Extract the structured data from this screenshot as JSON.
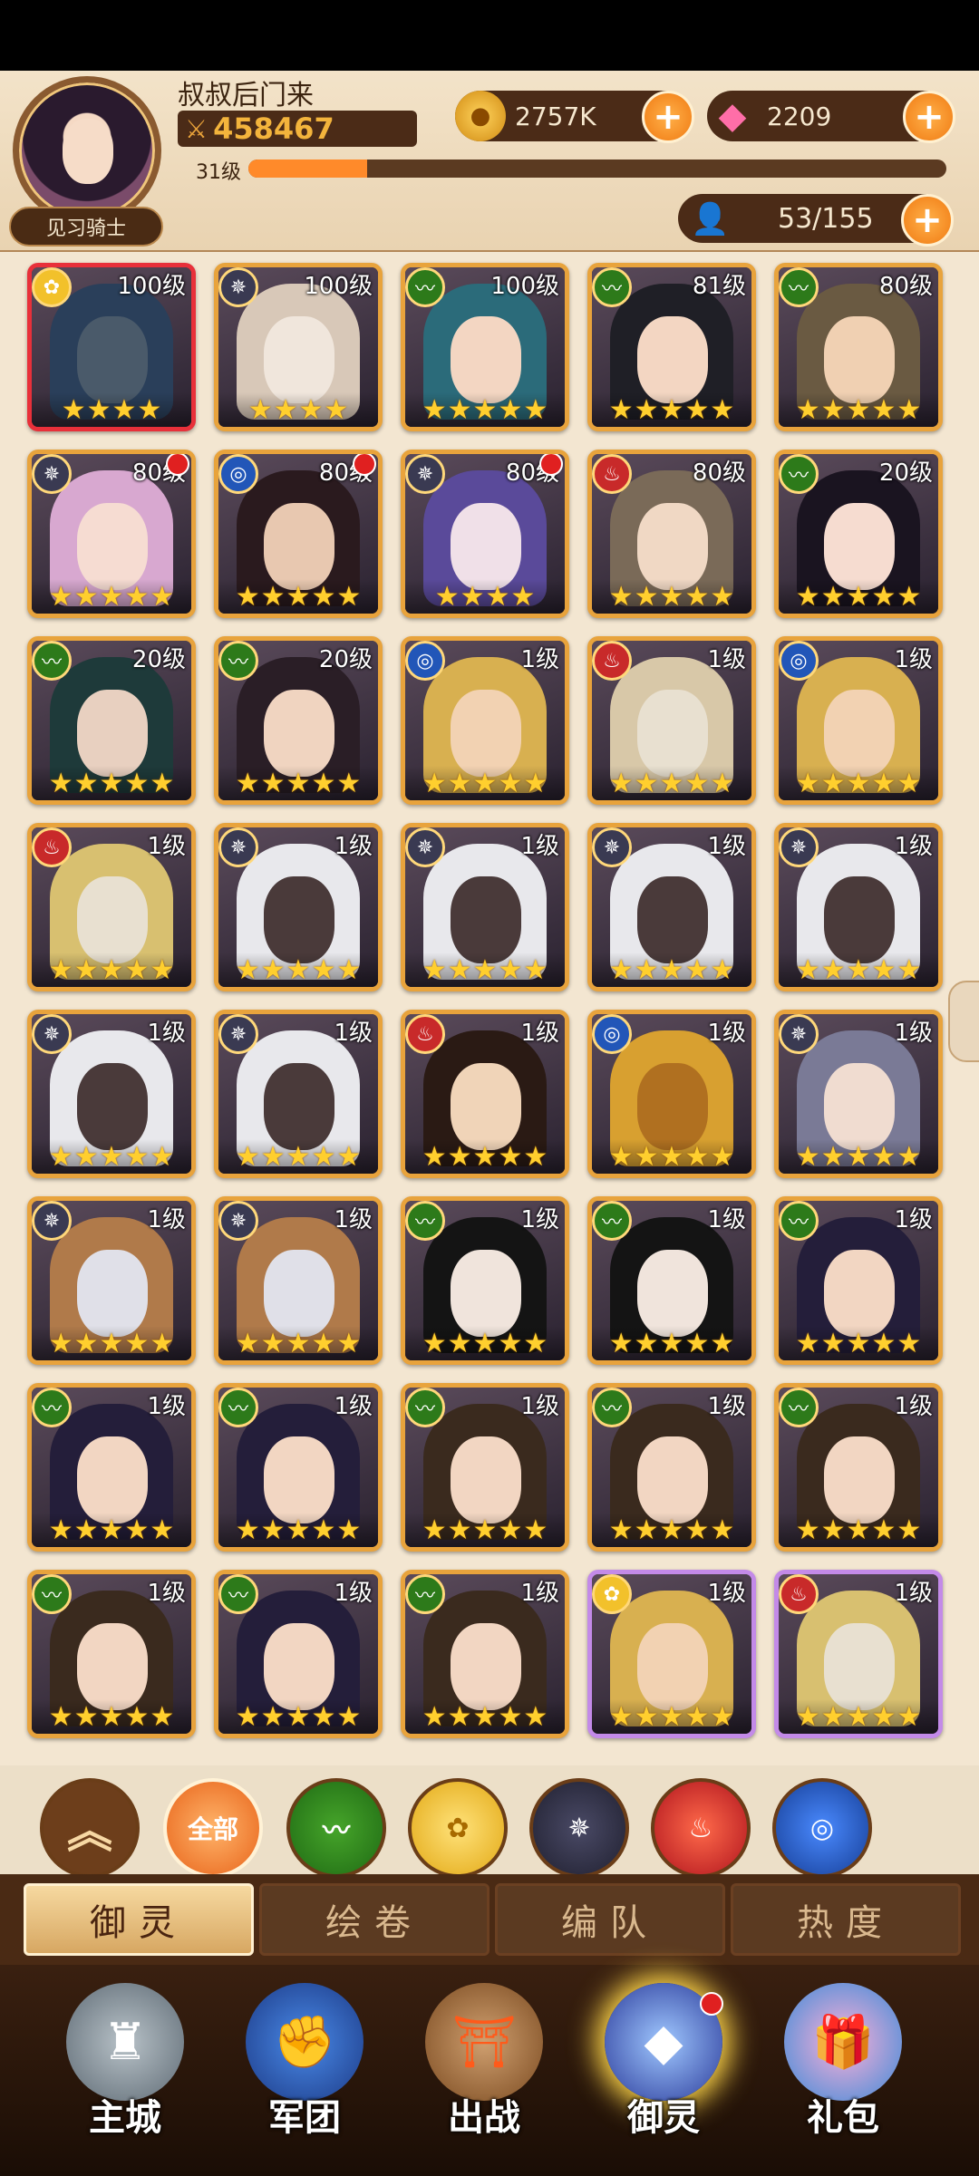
{
  "player": {
    "name": "叔叔后门来",
    "power": "458467",
    "level": "31级",
    "exp_fraction": 0.17,
    "rank": "见习骑士"
  },
  "resources": {
    "gold": "2757K",
    "gems": "2209",
    "roster": "53/155"
  },
  "cards": [
    {
      "level": "100级",
      "faction": "light",
      "frame": "red",
      "stars": 4,
      "dot": false,
      "hair": "#2a3f5a",
      "face": "#4a5a6a"
    },
    {
      "level": "100级",
      "faction": "dark",
      "frame": "gold",
      "stars": 4,
      "dot": false,
      "hair": "#d8c8b8",
      "face": "#f0e6dc"
    },
    {
      "level": "100级",
      "faction": "nature",
      "frame": "gold",
      "stars": 5,
      "dot": false,
      "hair": "#2b6b7a",
      "face": "#f3d6c2"
    },
    {
      "level": "81级",
      "faction": "nature",
      "frame": "gold",
      "stars": 5,
      "dot": false,
      "hair": "#1f1f26",
      "face": "#f3d6c2"
    },
    {
      "level": "80级",
      "faction": "nature",
      "frame": "gold",
      "stars": 5,
      "dot": false,
      "hair": "#6a5a42",
      "face": "#f0d0b2"
    },
    {
      "level": "80级",
      "faction": "dark",
      "frame": "gold",
      "stars": 5,
      "dot": true,
      "hair": "#d8a8d0",
      "face": "#f6dcd2"
    },
    {
      "level": "80级",
      "faction": "water",
      "frame": "gold",
      "stars": 5,
      "dot": true,
      "hair": "#2a1a1e",
      "face": "#e8c8b0"
    },
    {
      "level": "80级",
      "faction": "dark",
      "frame": "gold",
      "stars": 4,
      "dot": true,
      "hair": "#5a4a9a",
      "face": "#f0e0e8"
    },
    {
      "level": "80级",
      "faction": "fire",
      "frame": "gold",
      "stars": 5,
      "dot": false,
      "hair": "#7a6a58",
      "face": "#f0d8c4"
    },
    {
      "level": "20级",
      "faction": "nature",
      "frame": "gold",
      "stars": 5,
      "dot": false,
      "hair": "#1a1420",
      "face": "#f6dcd0"
    },
    {
      "level": "20级",
      "faction": "nature",
      "frame": "gold",
      "stars": 5,
      "dot": false,
      "hair": "#1e3a3a",
      "face": "#e8d0c0"
    },
    {
      "level": "20级",
      "faction": "nature",
      "frame": "gold",
      "stars": 5,
      "dot": false,
      "hair": "#2a1e26",
      "face": "#f0d4c0"
    },
    {
      "level": "1级",
      "faction": "water",
      "frame": "gold",
      "stars": 5,
      "dot": false,
      "hair": "#d8b050",
      "face": "#f2d2b2"
    },
    {
      "level": "1级",
      "faction": "fire",
      "frame": "gold",
      "stars": 5,
      "dot": false,
      "hair": "#d8c8a8",
      "face": "#e8e0d0"
    },
    {
      "level": "1级",
      "faction": "water",
      "frame": "gold",
      "stars": 5,
      "dot": false,
      "hair": "#d8b050",
      "face": "#f2d2b2"
    },
    {
      "level": "1级",
      "faction": "fire",
      "frame": "gold",
      "stars": 5,
      "dot": false,
      "hair": "#d8c070",
      "face": "#e8e0d0"
    },
    {
      "level": "1级",
      "faction": "dark",
      "frame": "gold",
      "stars": 5,
      "dot": false,
      "hair": "#e8e8ec",
      "face": "#4a3a3a"
    },
    {
      "level": "1级",
      "faction": "dark",
      "frame": "gold",
      "stars": 5,
      "dot": false,
      "hair": "#e8e8ec",
      "face": "#4a3a3a"
    },
    {
      "level": "1级",
      "faction": "dark",
      "frame": "gold",
      "stars": 5,
      "dot": false,
      "hair": "#e8e8ec",
      "face": "#4a3a3a"
    },
    {
      "level": "1级",
      "faction": "dark",
      "frame": "gold",
      "stars": 5,
      "dot": false,
      "hair": "#e8e8ec",
      "face": "#4a3a3a"
    },
    {
      "level": "1级",
      "faction": "dark",
      "frame": "gold",
      "stars": 5,
      "dot": false,
      "hair": "#e8e8ec",
      "face": "#4a3a3a"
    },
    {
      "level": "1级",
      "faction": "dark",
      "frame": "gold",
      "stars": 5,
      "dot": false,
      "hair": "#e8e8ec",
      "face": "#4a3a3a"
    },
    {
      "level": "1级",
      "faction": "fire",
      "frame": "gold",
      "stars": 5,
      "dot": false,
      "hair": "#2a1a14",
      "face": "#f0d4b8"
    },
    {
      "level": "1级",
      "faction": "water",
      "frame": "gold",
      "stars": 5,
      "dot": false,
      "hair": "#d8a030",
      "face": "#b07020"
    },
    {
      "level": "1级",
      "faction": "dark",
      "frame": "gold",
      "stars": 5,
      "dot": false,
      "hair": "#7a7a96",
      "face": "#f0dcd0"
    },
    {
      "level": "1级",
      "faction": "dark",
      "frame": "gold",
      "stars": 5,
      "dot": false,
      "hair": "#b07a4a",
      "face": "#e0e0e8"
    },
    {
      "level": "1级",
      "faction": "dark",
      "frame": "gold",
      "stars": 5,
      "dot": false,
      "hair": "#b07a4a",
      "face": "#e0e0e8"
    },
    {
      "level": "1级",
      "faction": "nature",
      "frame": "gold",
      "stars": 5,
      "dot": false,
      "hair": "#141414",
      "face": "#f0e4dc"
    },
    {
      "level": "1级",
      "faction": "nature",
      "frame": "gold",
      "stars": 5,
      "dot": false,
      "hair": "#141414",
      "face": "#f0e4dc"
    },
    {
      "level": "1级",
      "faction": "nature",
      "frame": "gold",
      "stars": 5,
      "dot": false,
      "hair": "#241e3a",
      "face": "#f2d6c2"
    },
    {
      "level": "1级",
      "faction": "nature",
      "frame": "gold",
      "stars": 5,
      "dot": false,
      "hair": "#241e3a",
      "face": "#f2d6c2"
    },
    {
      "level": "1级",
      "faction": "nature",
      "frame": "gold",
      "stars": 5,
      "dot": false,
      "hair": "#241e3a",
      "face": "#f2d6c2"
    },
    {
      "level": "1级",
      "faction": "nature",
      "frame": "gold",
      "stars": 5,
      "dot": false,
      "hair": "#3a2a1e",
      "face": "#f2d6c2"
    },
    {
      "level": "1级",
      "faction": "nature",
      "frame": "gold",
      "stars": 5,
      "dot": false,
      "hair": "#3a2a1e",
      "face": "#f2d6c2"
    },
    {
      "level": "1级",
      "faction": "nature",
      "frame": "gold",
      "stars": 5,
      "dot": false,
      "hair": "#3a2a1e",
      "face": "#f2d6c2"
    },
    {
      "level": "1级",
      "faction": "nature",
      "frame": "gold",
      "stars": 5,
      "dot": false,
      "hair": "#3a2a1e",
      "face": "#f2d6c2"
    },
    {
      "level": "1级",
      "faction": "nature",
      "frame": "gold",
      "stars": 5,
      "dot": false,
      "hair": "#241e3a",
      "face": "#f2d6c2"
    },
    {
      "level": "1级",
      "faction": "nature",
      "frame": "gold",
      "stars": 5,
      "dot": false,
      "hair": "#3a2a1e",
      "face": "#f2d6c2"
    },
    {
      "level": "1级",
      "faction": "light",
      "frame": "purple",
      "stars": 5,
      "dot": false,
      "hair": "#d8b050",
      "face": "#f2d2b2"
    },
    {
      "level": "1级",
      "faction": "fire",
      "frame": "purple",
      "stars": 5,
      "dot": false,
      "hair": "#d8c070",
      "face": "#e8e0d0"
    }
  ],
  "filters": {
    "up_icon": "chevron-up-icon",
    "all": "全部",
    "nature_icon": "nature-faction-icon",
    "light_icon": "light-faction-icon",
    "dark_icon": "dark-faction-icon",
    "fire_icon": "fire-faction-icon",
    "water_icon": "water-faction-icon"
  },
  "subtabs": {
    "yuling": "御灵",
    "huijuan": "绘卷",
    "biandui": "编队",
    "redu": "热度"
  },
  "nav": {
    "city": "主城",
    "legion": "军团",
    "battle": "出战",
    "spirit": "御灵",
    "gift": "礼包"
  },
  "colors": {
    "accent": "#f07a12",
    "frame_gold": "#e8a33c",
    "frame_purple": "#c38ae8",
    "badge_red": "#e02020"
  }
}
